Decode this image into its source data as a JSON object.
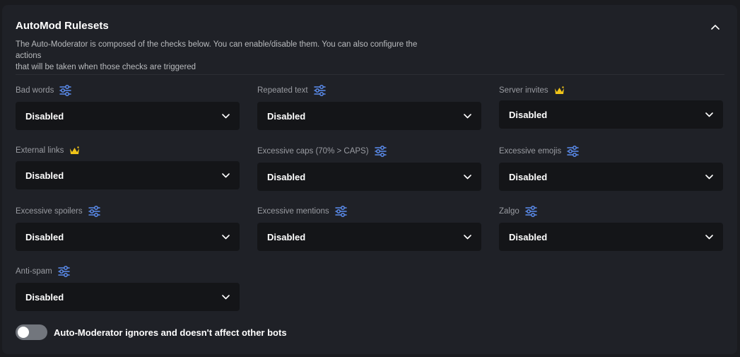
{
  "header": {
    "title": "AutoMod Rulesets",
    "description_line1": "The Auto-Moderator is composed of the checks below. You can enable/disable them. You can also configure the actions",
    "description_line2": "that will be taken when those checks are triggered"
  },
  "colors": {
    "accent": "#5b8def",
    "crown": "#f0c419",
    "panel": "#1f2127",
    "select_bg": "#141518"
  },
  "rules": [
    {
      "label": "Bad words",
      "icon": "settings-sliders-icon",
      "value": "Disabled"
    },
    {
      "label": "Repeated text",
      "icon": "settings-sliders-icon",
      "value": "Disabled"
    },
    {
      "label": "Server invites",
      "icon": "premium-crown-icon",
      "value": "Disabled"
    },
    {
      "label": "External links",
      "icon": "premium-crown-icon",
      "value": "Disabled"
    },
    {
      "label": "Excessive caps (70% > CAPS)",
      "icon": "settings-sliders-icon",
      "value": "Disabled"
    },
    {
      "label": "Excessive emojis",
      "icon": "settings-sliders-icon",
      "value": "Disabled"
    },
    {
      "label": "Excessive spoilers",
      "icon": "settings-sliders-icon",
      "value": "Disabled"
    },
    {
      "label": "Excessive mentions",
      "icon": "settings-sliders-icon",
      "value": "Disabled"
    },
    {
      "label": "Zalgo",
      "icon": "settings-sliders-icon",
      "value": "Disabled"
    },
    {
      "label": "Anti-spam",
      "icon": "settings-sliders-icon",
      "value": "Disabled"
    }
  ],
  "ignore_bots": {
    "label": "Auto-Moderator ignores and doesn't affect other bots",
    "enabled": false
  }
}
